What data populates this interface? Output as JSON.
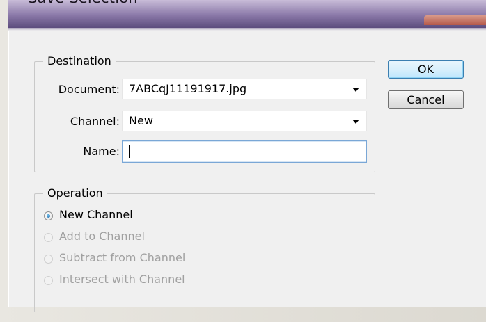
{
  "window": {
    "title": "Save Selection"
  },
  "destination": {
    "legend": "Destination",
    "document_label": "Document:",
    "document_value": "7ABCqJ11191917.jpg",
    "channel_label": "Channel:",
    "channel_value": "New",
    "name_label": "Name:",
    "name_value": ""
  },
  "operation": {
    "legend": "Operation",
    "options": [
      {
        "label": "New Channel",
        "selected": true,
        "enabled": true
      },
      {
        "label": "Add to Channel",
        "selected": false,
        "enabled": false
      },
      {
        "label": "Subtract from Channel",
        "selected": false,
        "enabled": false
      },
      {
        "label": "Intersect with Channel",
        "selected": false,
        "enabled": false
      }
    ]
  },
  "buttons": {
    "ok_label": "OK",
    "cancel_label": "Cancel"
  }
}
